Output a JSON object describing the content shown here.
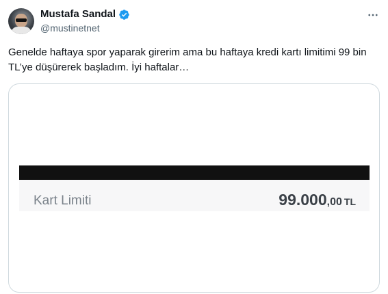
{
  "tweet": {
    "author": {
      "display_name": "Mustafa Sandal",
      "handle": "@mustinetnet",
      "verified": true,
      "avatar_icon": "user-avatar"
    },
    "more_icon": "ellipsis-icon",
    "text": "Genelde haftaya spor yaparak girerim ama bu haftaya kredi kartı limitimi 99 bin TL’ye düşürerek başladım. İyi haftalar…",
    "media": {
      "label": "Kart Limiti",
      "amount_integer": "99.000",
      "amount_decimal": ",00",
      "currency": "TL"
    }
  },
  "colors": {
    "verified_blue": "#1d9bf0",
    "secondary_text": "#536471",
    "border": "#cfd9de"
  }
}
